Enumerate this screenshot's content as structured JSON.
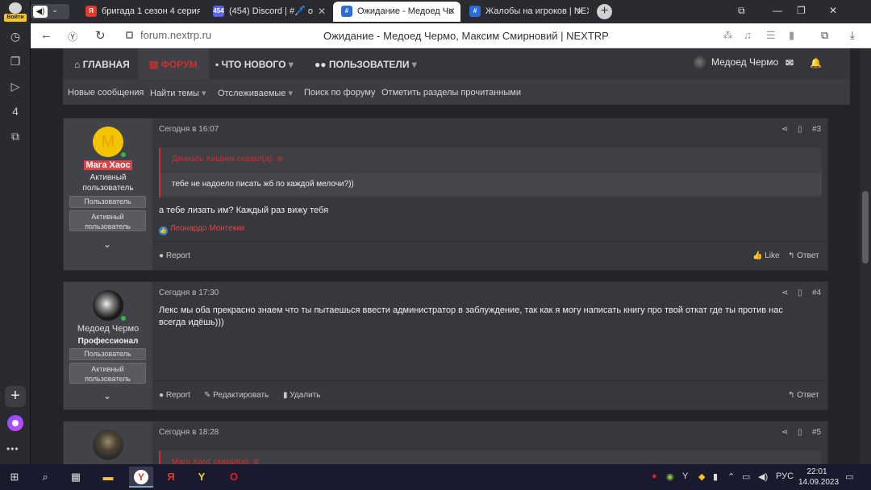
{
  "browser": {
    "login_label": "Войти",
    "tabs": [
      {
        "label": "бригада 1 сезон 4 серия v",
        "fav_text": "Я",
        "fav_color": "#e23b2e"
      },
      {
        "label": "(454) Discord | #🖊️ o",
        "fav_text": "454",
        "fav_color": "#5865f2"
      },
      {
        "label": "Ожидание - Медоед Чо",
        "fav_text": "#",
        "fav_color": "#2b6cd8",
        "active": true
      },
      {
        "label": "Жалобы на игроков | NEX",
        "fav_text": "#",
        "fav_color": "#2b6cd8"
      }
    ],
    "url": "forum.nextrp.ru",
    "page_title": "Ожидание - Медоед Чермо, Максим Смирновий | NEXTRP"
  },
  "site": {
    "nav": {
      "home": "ГЛАВНАЯ",
      "forum": "ФОРУМ",
      "whats_new": "ЧТО НОВОГО",
      "members": "ПОЛЬЗОВАТЕЛИ",
      "user_name": "Медоед Чермо"
    },
    "subnav": {
      "new_posts": "Новые сообщения",
      "find_threads": "Найти темы",
      "watched": "Отслеживаемые",
      "search": "Поиск по форуму",
      "mark_read": "Отметить разделы прочитанными"
    }
  },
  "posts": [
    {
      "avatar_letter": "M",
      "author": "Мага Хаос",
      "user_title": "Активный пользователь",
      "banners": [
        "Пользователь",
        "Активный пользователь"
      ],
      "time": "Сегодня в 16:07",
      "number": "#3",
      "quote_header": "Даниэль Хищник сказал(а): ⊕",
      "quote_text": "тебе не надоело писать жб по каждой мелочи?))",
      "message": "а тебе лизать им? Каждый раз вижу тебя",
      "reaction_user": "Леонардо Монтекки",
      "actions": {
        "report": "Report",
        "like": "Like",
        "reply": "Ответ"
      }
    },
    {
      "author": "Медоед Чермо",
      "user_title": "Профессионал",
      "banners": [
        "Пользователь",
        "Активный пользователь"
      ],
      "time": "Сегодня в 17:30",
      "number": "#4",
      "message": "Лекс мы оба прекрасно знаем что ты пытаешься ввести администратор в заблуждение, так как я могу написать книгу про твой откат где ты против нас всегда идёшь)))",
      "actions": {
        "report": "Report",
        "edit": "Редактировать",
        "delete": "Удалить",
        "reply": "Ответ"
      }
    },
    {
      "time": "Сегодня в 18:28",
      "number": "#5",
      "quote_header": "Мага Хаос сказал(а): ⊕"
    }
  ],
  "taskbar": {
    "lang": "РУС",
    "time": "22:01",
    "date": "14.09.2023"
  },
  "colors": {
    "accent": "#c9312f",
    "name_highlight": "#d64545"
  }
}
